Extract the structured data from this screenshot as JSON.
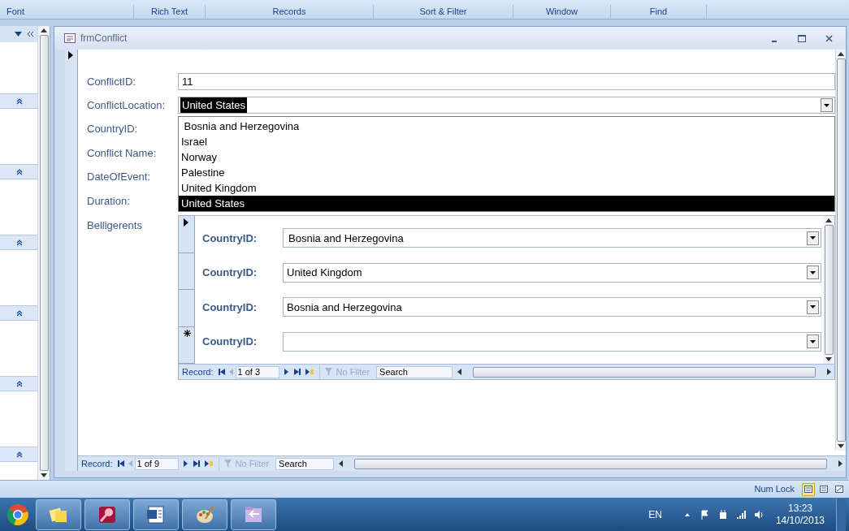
{
  "ribbon_groups": [
    "Font",
    "Rich Text",
    "Records",
    "Sort & Filter",
    "Window",
    "Find"
  ],
  "form": {
    "title": "frmConflict",
    "fields": [
      {
        "label": "ConflictID:",
        "kind": "text",
        "value": "11"
      },
      {
        "label": "ConflictLocation:",
        "kind": "combo",
        "value": "United States"
      }
    ],
    "hidden_labels": [
      "CountryID:",
      "Conflict Name:",
      "DateOfEvent:",
      "Duration:"
    ],
    "dropdown": {
      "options": [
        {
          "text": " Bosnia and Herzegovina",
          "selected": false
        },
        {
          "text": "Israel",
          "selected": false
        },
        {
          "text": "Norway",
          "selected": false
        },
        {
          "text": "Palestine",
          "selected": false
        },
        {
          "text": "United Kingdom",
          "selected": false
        },
        {
          "text": "United States",
          "selected": true
        }
      ]
    },
    "subform": {
      "label": "Belligerents",
      "rows": [
        {
          "label": "CountryID:",
          "value": "Bosnia and Herzegovina",
          "kind": "current"
        },
        {
          "label": "CountryID:",
          "value": "United Kingdom",
          "kind": "normal"
        },
        {
          "label": "CountryID:",
          "value": "Bosnia and Herzegovina",
          "kind": "normal"
        },
        {
          "label": "CountryID:",
          "kind": "new"
        }
      ],
      "nav": {
        "label": "Record:",
        "position": "1 of 3",
        "filter": "No Filter",
        "search": "Search"
      }
    },
    "nav": {
      "label": "Record:",
      "position": "1 of 9",
      "filter": "No Filter",
      "search": "Search"
    }
  },
  "status": {
    "text": "Num Lock",
    "views": [
      {
        "selected": true
      },
      {
        "selected": false
      },
      {
        "selected": false
      }
    ]
  },
  "taskbar": {
    "language": "EN",
    "time": "13:23",
    "date": "14/10/2013"
  }
}
